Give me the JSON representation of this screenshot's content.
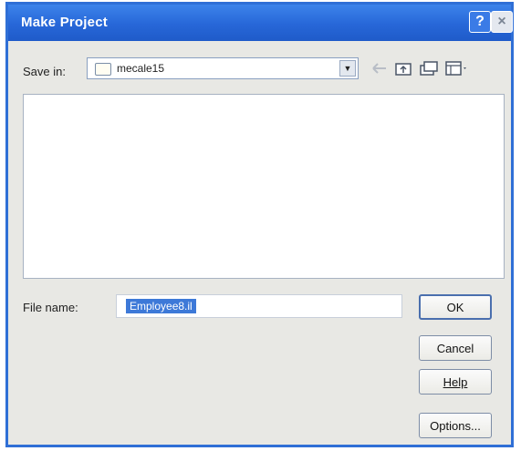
{
  "dialog": {
    "title": "Make Project",
    "help_glyph": "?",
    "close_glyph": "×"
  },
  "save_in": {
    "label": "Save in:",
    "value": "mecale15",
    "arrow": "▼"
  },
  "toolbar": {
    "icons": [
      "back-icon",
      "up-folder-icon",
      "new-folder-icon",
      "views-menu-icon"
    ]
  },
  "file_list": {
    "items": []
  },
  "file_name": {
    "label": "File name:",
    "value": "Employee8.il"
  },
  "buttons": {
    "ok": "OK",
    "cancel": "Cancel",
    "help": "Help",
    "options": "Options..."
  },
  "colors": {
    "titlebar": "#2767d8",
    "selection": "#3d79d8",
    "dialog_bg": "#e8e8e4"
  }
}
